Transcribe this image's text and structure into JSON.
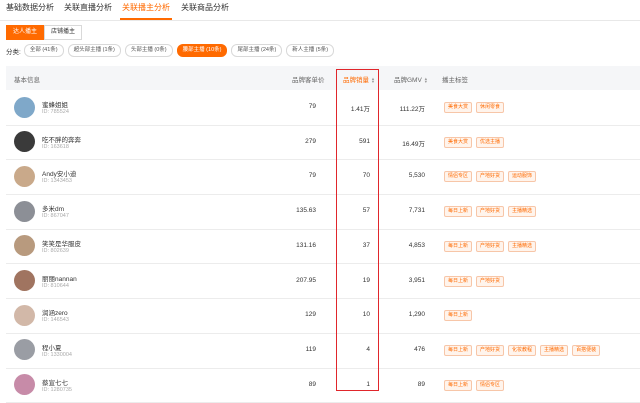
{
  "tabs": [
    "基础数据分析",
    "关联直播分析",
    "关联播主分析",
    "关联商品分析"
  ],
  "active_tab_index": 2,
  "subtabs": [
    "达人播主",
    "店铺播主"
  ],
  "filter": {
    "label": "分类:",
    "chips": [
      "全部 (41条)",
      "超头部主播 (1条)",
      "头部主播 (0条)",
      "腰部主播 (10条)",
      "尾部主播 (24条)",
      "新人主播 (5条)"
    ],
    "active_index": 3
  },
  "columns": [
    "基本信息",
    "品牌客单价",
    "品牌销量",
    "品牌GMV",
    "播主标签"
  ],
  "rows": [
    {
      "name": "蜜蜂姐姐",
      "id": "ID: 785524",
      "price": "79",
      "sales": "1.41万",
      "gmv": "111.22万",
      "tags": [
        "美食大赏",
        "休闲零食"
      ],
      "avatar_color": "#7fa8c9"
    },
    {
      "name": "吃不胖的奔奔",
      "id": "ID: 163618",
      "price": "279",
      "sales": "591",
      "gmv": "16.49万",
      "tags": [
        "美食大赏",
        "优选主播"
      ],
      "avatar_color": "#3a3a3a"
    },
    {
      "name": "Andy安小迪",
      "id": "ID: 1343453",
      "price": "79",
      "sales": "70",
      "gmv": "5,530",
      "tags": [
        "情侣专区",
        "产地好货",
        "运动服饰"
      ],
      "avatar_color": "#c9a98a"
    },
    {
      "name": "多米dm",
      "id": "ID: 867047",
      "price": "135.63",
      "sales": "57",
      "gmv": "7,731",
      "tags": [
        "每日上新",
        "产地好货",
        "主播精选"
      ],
      "avatar_color": "#8c8f96"
    },
    {
      "name": "笑笑是华服皮",
      "id": "ID: 802639",
      "price": "131.16",
      "sales": "37",
      "gmv": "4,853",
      "tags": [
        "每日上新",
        "产地好货",
        "主播精选"
      ],
      "avatar_color": "#b89a7e"
    },
    {
      "name": "丽丽nannan",
      "id": "ID: 810644",
      "price": "207.95",
      "sales": "19",
      "gmv": "3,951",
      "tags": [
        "每日上新",
        "产地好货"
      ],
      "avatar_color": "#a07460"
    },
    {
      "name": "润涵zero",
      "id": "ID: 146543",
      "price": "129",
      "sales": "10",
      "gmv": "1,290",
      "tags": [
        "每日上新"
      ],
      "avatar_color": "#d2b8a8"
    },
    {
      "name": "程小夏",
      "id": "ID: 1330004",
      "price": "119",
      "sales": "4",
      "gmv": "476",
      "tags": [
        "每日上新",
        "产地好货",
        "化妆教程",
        "主播精选",
        "百搭便装"
      ],
      "avatar_color": "#9a9da4"
    },
    {
      "name": "蔡宣七七",
      "id": "ID: 1280735",
      "price": "89",
      "sales": "1",
      "gmv": "89",
      "tags": [
        "每日上新",
        "情侣专区"
      ],
      "avatar_color": "#c78ba8"
    }
  ],
  "colors": {
    "accent": "#ff6a00",
    "highlight_box": "#e0262b"
  }
}
